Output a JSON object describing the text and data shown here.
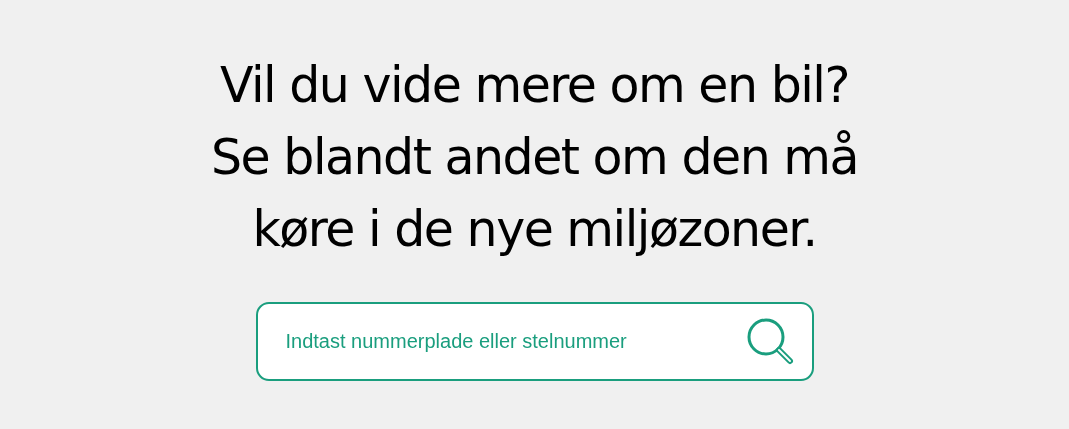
{
  "heading": {
    "lines": [
      "Vil du vide mere om en bil?",
      "Se blandt andet om den må",
      "køre i de nye miljøzoner."
    ]
  },
  "search": {
    "placeholder": "Indtast nummerplade eller stelnummer"
  }
}
